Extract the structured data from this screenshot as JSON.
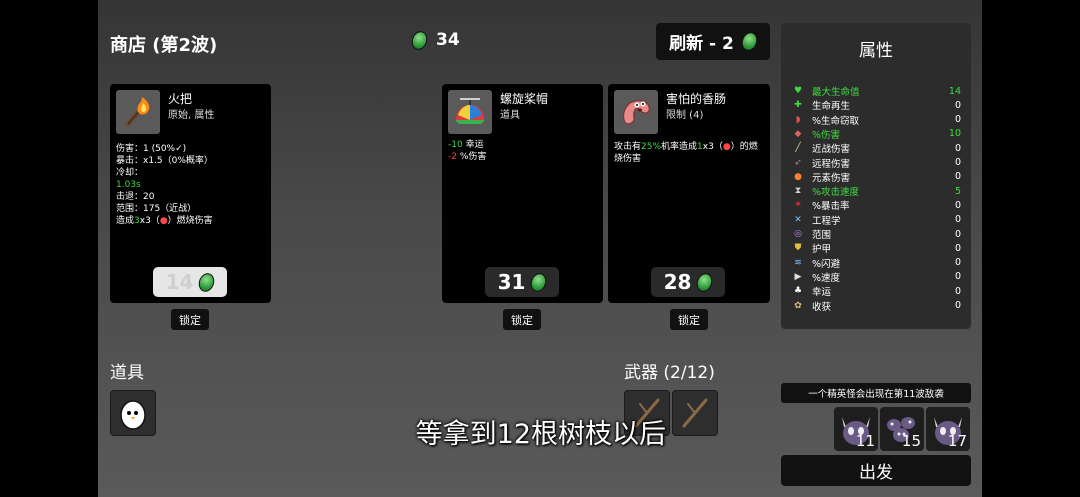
{
  "header": {
    "shop_title": "商店 (第2波)",
    "materials_count": "34",
    "reroll_label": "刷新 - 2"
  },
  "shop_items": [
    {
      "name": "火把",
      "type": "原始, 属性",
      "icon": "torch-icon",
      "stats": [
        {
          "parts": [
            {
              "t": "伤害：1 (50%",
              "c": ""
            },
            {
              "t": "✓",
              "c": ""
            },
            {
              "t": ")",
              "c": ""
            }
          ]
        },
        {
          "parts": [
            {
              "t": "暴击：x1.5（0%概率）",
              "c": ""
            }
          ]
        },
        {
          "parts": [
            {
              "t": "冷却：",
              "c": ""
            }
          ]
        },
        {
          "parts": [
            {
              "t": "1.03s",
              "c": "green"
            }
          ]
        },
        {
          "parts": [
            {
              "t": "击退：20",
              "c": ""
            }
          ]
        },
        {
          "parts": [
            {
              "t": "范围：175（近战）",
              "c": ""
            }
          ]
        },
        {
          "parts": [
            {
              "t": "造成",
              "c": ""
            },
            {
              "t": "3",
              "c": "green"
            },
            {
              "t": "x3（",
              "c": ""
            },
            {
              "t": "●",
              "c": "red"
            },
            {
              "t": "）燃烧伤害",
              "c": ""
            }
          ]
        }
      ],
      "price": "14",
      "locked": true,
      "lock_label": "锁定"
    },
    {
      "name": "螺旋桨帽",
      "type": "道具",
      "icon": "propeller-hat-icon",
      "stats": [
        {
          "parts": [
            {
              "t": "-10",
              "c": "green"
            },
            {
              "t": " 幸运",
              "c": ""
            }
          ]
        },
        {
          "parts": [
            {
              "t": "-2",
              "c": "red"
            },
            {
              "t": " %伤害",
              "c": ""
            }
          ]
        }
      ],
      "price": "31",
      "locked": false,
      "lock_label": "锁定"
    },
    {
      "name": "害怕的香肠",
      "type": "限制 (4)",
      "icon": "scared-sausage-icon",
      "stats": [
        {
          "parts": [
            {
              "t": "攻击有",
              "c": ""
            },
            {
              "t": "25%",
              "c": "green"
            },
            {
              "t": "机率造成",
              "c": ""
            },
            {
              "t": "1",
              "c": "green"
            },
            {
              "t": "x3（",
              "c": ""
            },
            {
              "t": "●",
              "c": "red"
            },
            {
              "t": "）的燃",
              "c": ""
            }
          ]
        },
        {
          "parts": [
            {
              "t": "烧伤害",
              "c": ""
            }
          ]
        }
      ],
      "price": "28",
      "locked": false,
      "lock_label": "锁定"
    }
  ],
  "attributes": {
    "title": "属性",
    "rows": [
      {
        "label": "最大生命值",
        "value": "14",
        "highlight": true,
        "icon": "heart-icon",
        "color": "#3fdc3f"
      },
      {
        "label": "生命再生",
        "value": "0",
        "highlight": false,
        "icon": "regen-icon",
        "color": "#3fdc3f"
      },
      {
        "label": "%生命窃取",
        "value": "0",
        "highlight": false,
        "icon": "lifesteal-icon",
        "color": "#e05050"
      },
      {
        "label": "%伤害",
        "value": "10",
        "highlight": true,
        "icon": "damage-icon",
        "color": "#e06060"
      },
      {
        "label": "近战伤害",
        "value": "0",
        "highlight": false,
        "icon": "melee-icon",
        "color": "#e0d0b0"
      },
      {
        "label": "远程伤害",
        "value": "0",
        "highlight": false,
        "icon": "ranged-icon",
        "color": "#c08080"
      },
      {
        "label": "元素伤害",
        "value": "0",
        "highlight": false,
        "icon": "elemental-icon",
        "color": "#ff8030"
      },
      {
        "label": "%攻击速度",
        "value": "5",
        "highlight": true,
        "icon": "attack-speed-icon",
        "color": "#d0d0d0"
      },
      {
        "label": "%暴击率",
        "value": "0",
        "highlight": false,
        "icon": "crit-icon",
        "color": "#e03030"
      },
      {
        "label": "工程学",
        "value": "0",
        "highlight": false,
        "icon": "engineering-icon",
        "color": "#70c0ff"
      },
      {
        "label": "范围",
        "value": "0",
        "highlight": false,
        "icon": "range-icon",
        "color": "#c080ff"
      },
      {
        "label": "护甲",
        "value": "0",
        "highlight": false,
        "icon": "armor-icon",
        "color": "#e0c040"
      },
      {
        "label": "%闪避",
        "value": "0",
        "highlight": false,
        "icon": "dodge-icon",
        "color": "#80c0ff"
      },
      {
        "label": "%速度",
        "value": "0",
        "highlight": false,
        "icon": "speed-icon",
        "color": "#e0e0e0"
      },
      {
        "label": "幸运",
        "value": "0",
        "highlight": false,
        "icon": "luck-icon",
        "color": "#ffffff"
      },
      {
        "label": "收获",
        "value": "0",
        "highlight": false,
        "icon": "harvest-icon",
        "color": "#e0c080"
      }
    ]
  },
  "items_section": {
    "title": "道具",
    "items": [
      "egg-icon"
    ]
  },
  "weapons_section": {
    "title": "武器 (2/12)",
    "items": [
      "stick-icon",
      "stick-icon"
    ]
  },
  "elite_notice": "一个精英怪会出现在第11波敌袭",
  "waves": [
    "11",
    "15",
    "17"
  ],
  "go_button": "出发",
  "subtitle": "等拿到12根树枝以后"
}
